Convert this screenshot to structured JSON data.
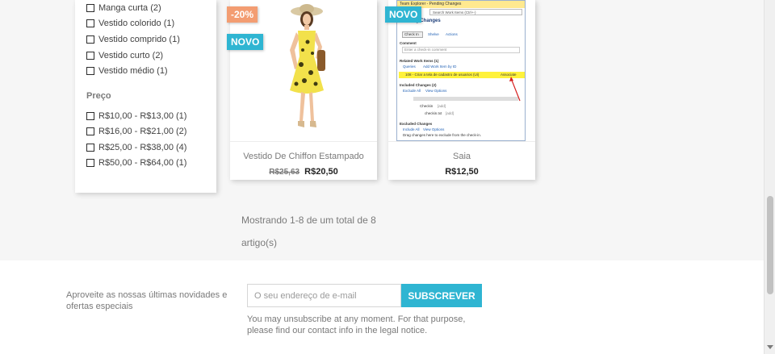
{
  "filters": {
    "dress_types": [
      {
        "label": "Manga curta (2)"
      },
      {
        "label": "Vestido colorido (1)"
      },
      {
        "label": "Vestido comprido (1)"
      },
      {
        "label": "Vestido curto (2)"
      },
      {
        "label": "Vestido médio (1)"
      }
    ],
    "price_title": "Preço",
    "prices": [
      {
        "label": "R$10,00 - R$13,00 (1)"
      },
      {
        "label": "R$16,00 - R$21,00 (2)"
      },
      {
        "label": "R$25,00 - R$38,00 (4)"
      },
      {
        "label": "R$50,00 - R$64,00 (1)"
      }
    ]
  },
  "products": [
    {
      "name": "Vestido De Chiffon Estampado",
      "old_price": "R$25,63",
      "price": "R$20,50",
      "flags": {
        "discount": "-20%",
        "new": "NOVO"
      }
    },
    {
      "name": "Saia",
      "price": "R$12,50",
      "flags": {
        "new": "NOVO"
      }
    }
  ],
  "vs_screenshot": {
    "title": "Team Explorer - Pending Changes",
    "search": "Search Work Items (Ctrl+-)",
    "header": "Pending Changes",
    "check_in": "Check In",
    "shelve": "Shelve",
    "actions": "Actions",
    "comment_label": "Comment",
    "comment_placeholder": "Enter a check-in comment",
    "related": "Related Work Items (1)",
    "queries": "Queries",
    "add_work_item": "Add Work Item by ID",
    "work_item": "108 - Criar a tela de cadastro de usuarios (Ui)",
    "associate": "Associate",
    "included": "Included Changes (2)",
    "exclude_all": "Exclude All",
    "view_options": "View Options",
    "folder": "Checkin",
    "folder_note": "[add]",
    "file": "checkin.txt",
    "file_note": "[add]",
    "excluded": "Excluded Changes",
    "include_all": "Include All",
    "drag_hint": "Drag changes here to exclude from the check-in."
  },
  "pagination": {
    "summary": "Mostrando 1-8 de um total de 8 artigo(s)"
  },
  "newsletter": {
    "text": "Aproveite as nossas últimas novidades e ofertas especiais",
    "placeholder": "O seu endereço de e-mail",
    "button": "SUBSCREVER",
    "note": "You may unsubscribe at any moment. For that purpose, please find our contact info in the legal notice."
  },
  "colors": {
    "accent": "#2fb5d2",
    "discount": "#f39d72"
  }
}
